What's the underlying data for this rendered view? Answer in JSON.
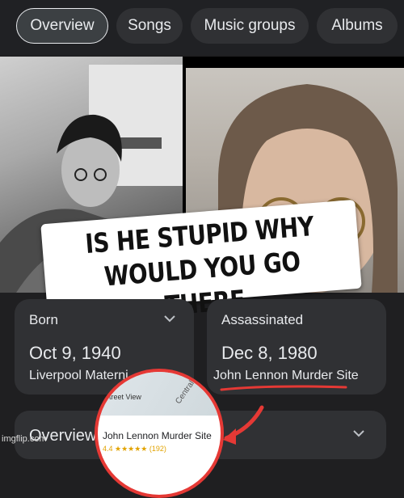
{
  "tabs": [
    {
      "label": "Overview",
      "active": true
    },
    {
      "label": "Songs",
      "active": false
    },
    {
      "label": "Music groups",
      "active": false
    },
    {
      "label": "Albums",
      "active": false
    }
  ],
  "meme": {
    "caption_line1": "IS HE STUPID WHY",
    "caption_line2": "WOULD YOU GO THERE"
  },
  "cards": {
    "born": {
      "label": "Born",
      "date": "Oct 9, 1940",
      "place": "Liverpool Materni..."
    },
    "assassinated": {
      "label": "Assassinated",
      "date": "Dec 8, 1980",
      "place": "John Lennon Murder Site"
    },
    "overview": {
      "label": "Overview"
    }
  },
  "zoom": {
    "street_view": "Street View",
    "road": "Central",
    "title": "John Lennon Murder Site",
    "rating": "4.4 ★★★★★ (192)"
  },
  "watermark": "imgflip.com",
  "colors": {
    "accent_red": "#e53935",
    "card_bg": "#303134",
    "page_bg": "#1f1f21"
  }
}
